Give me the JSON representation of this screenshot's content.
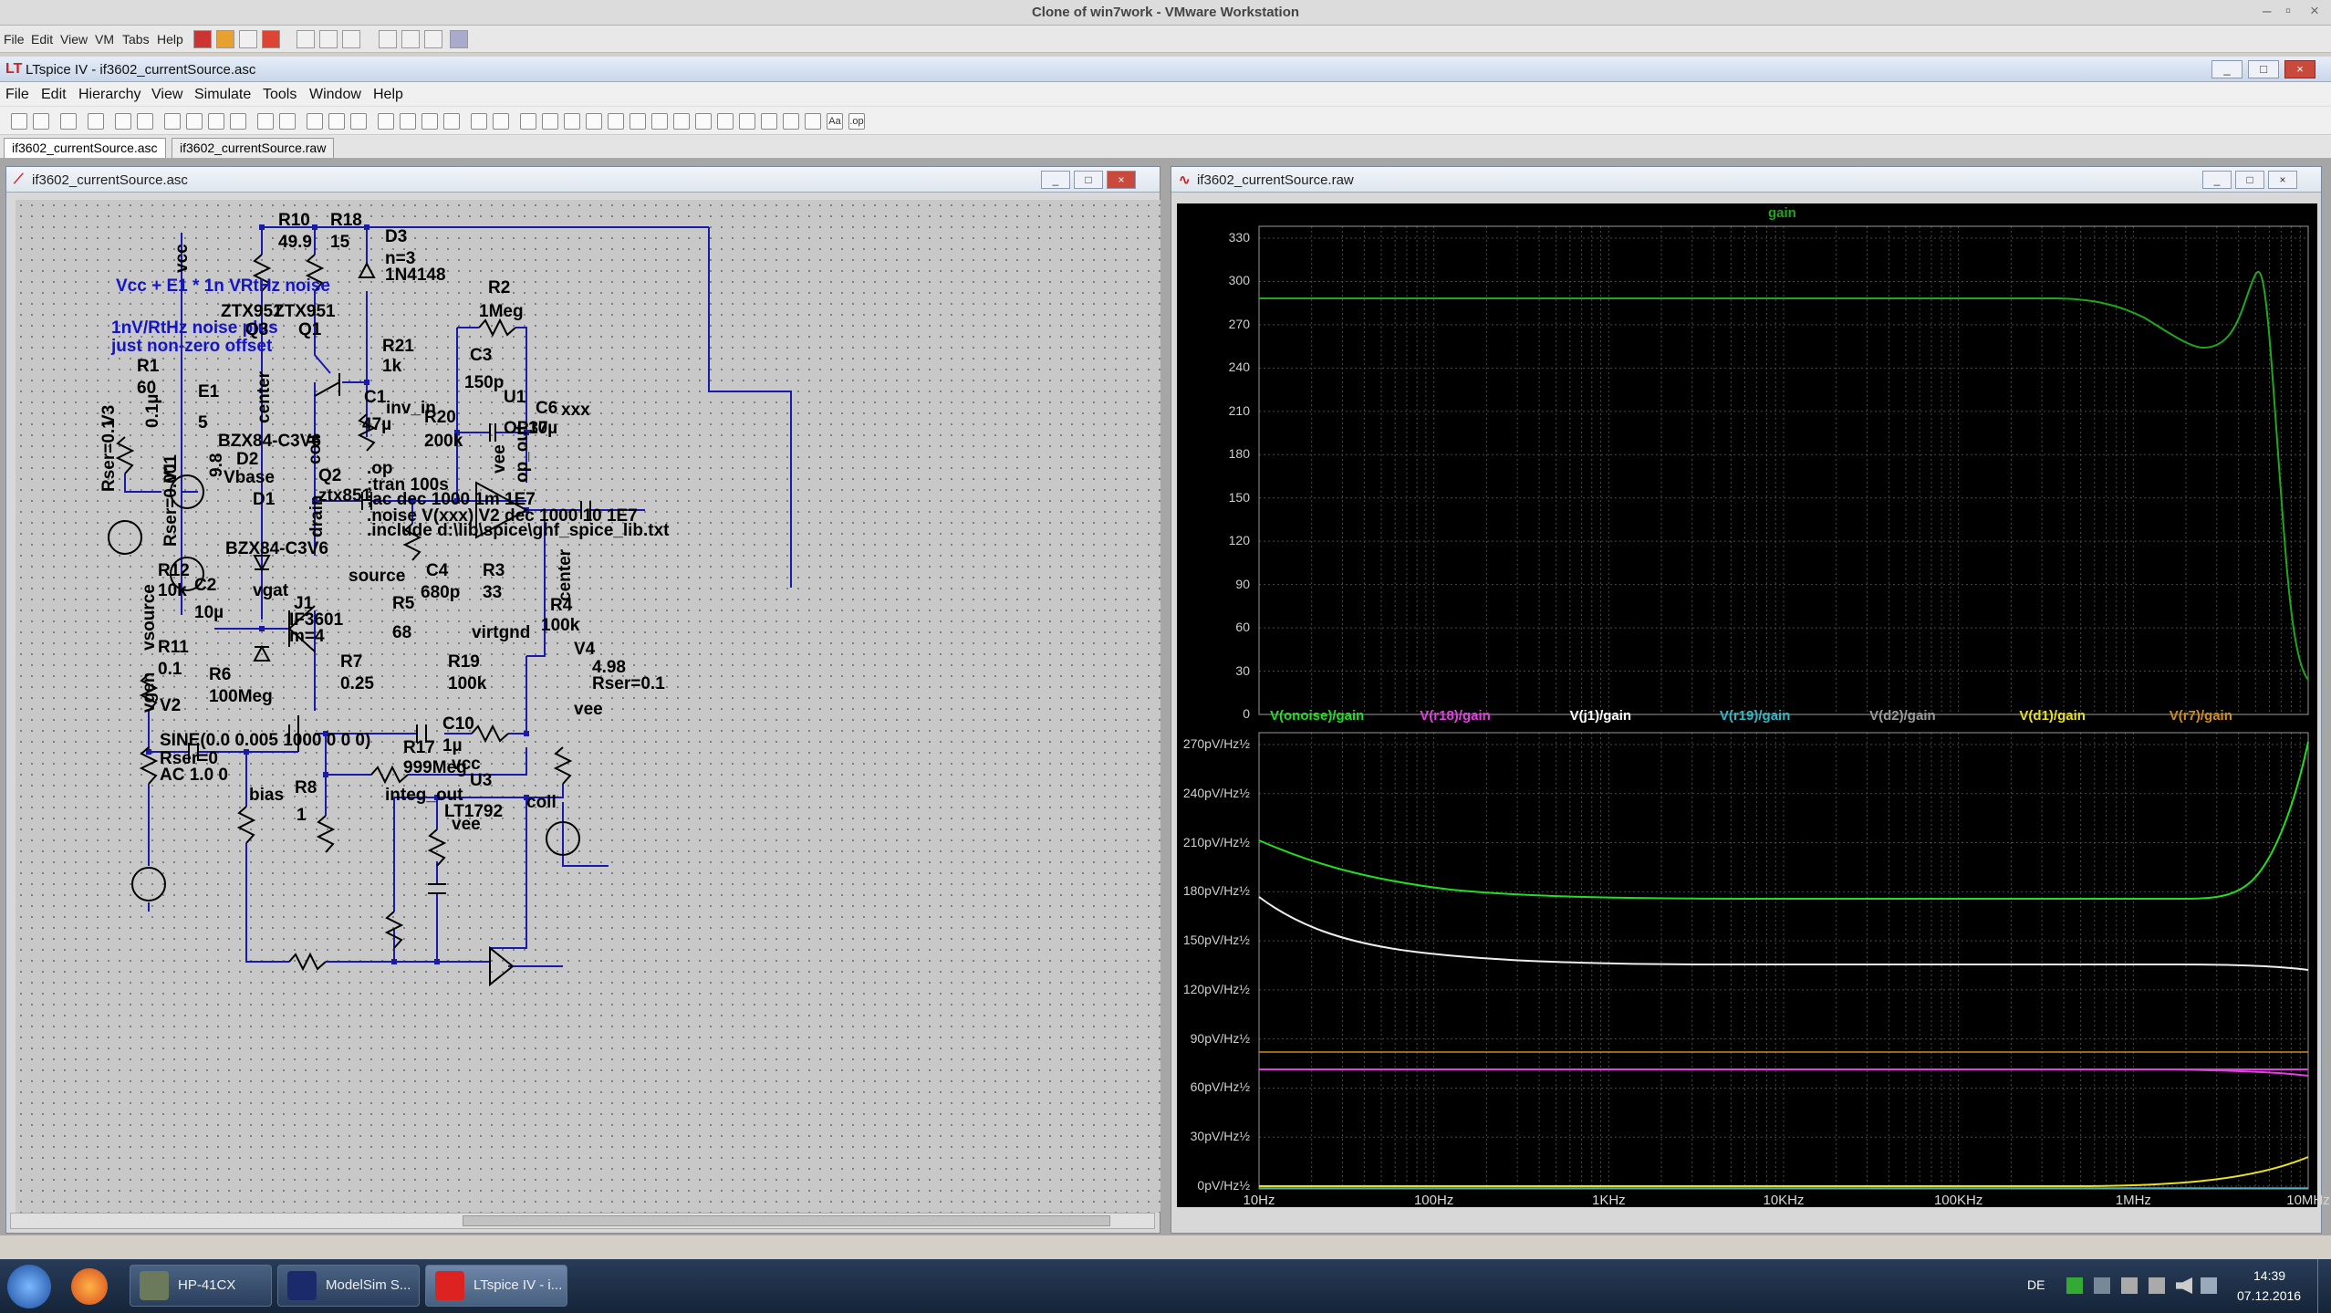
{
  "vmware": {
    "title": "Clone of win7work - VMware Workstation",
    "menu": [
      "File",
      "Edit",
      "View",
      "VM",
      "Tabs",
      "Help"
    ]
  },
  "ltspice": {
    "title": "LTspice IV - if3602_currentSource.asc",
    "menu": [
      "File",
      "Edit",
      "Hierarchy",
      "View",
      "Simulate",
      "Tools",
      "Window",
      "Help"
    ],
    "tabs": [
      "if3602_currentSource.asc",
      "if3602_currentSource.raw"
    ]
  },
  "schematic_window": {
    "title": "if3602_currentSource.asc",
    "labels": {
      "vcc_top": "vcc",
      "vcc_noise": "Vcc + E1 * 1n VRtHz noise",
      "noise1": "1nV/RtHz noise plus",
      "noise2": "just non-zero offset",
      "r10": "R10",
      "r10v": "49.9",
      "r18": "R18",
      "r18v": "15",
      "d3": "D3",
      "d3n": "n=3",
      "d3v": "1N4148",
      "r2": "R2",
      "r2v": "1Meg",
      "ztx1": "ZTX951",
      "ztx2": "ZTX951",
      "q3": "Q3",
      "q1": "Q1",
      "r21": "R21",
      "r21v": "1k",
      "c3": "C3",
      "c3v": "150p",
      "r1": "R1",
      "r1v": "60",
      "e1": "E1",
      "e1v": "5",
      "center": "center",
      "c1": "C1",
      "c1v": "47µ",
      "inv_in": "inv_in",
      "u1": "U1",
      "c6": "C6",
      "c6v": "10µ",
      "xxx": "xxx",
      "v3": "V3",
      "v3v": "0.1µ",
      "r20": "R20",
      "r20v": "200k",
      "op37": "OP37",
      "rser01": "Rser=0.1",
      "bzx1": "BZX84-C3V6",
      "d2": "D2",
      "coll": "coll",
      "vee1": "vee",
      "op_out": "op_out",
      "v1": "V1",
      "v1v": "9.8",
      "vbase": "Vbase",
      "q2": "Q2",
      "ztx851": "ztx851",
      "d1": "D1",
      "rser0001": "Rser=0.001",
      "dot_op": ".op",
      "dot_tran": ";tran 100s",
      "dot_ac": ";ac dec 1000 1m 1E7",
      "dot_noise": ".noise V(xxx) V2 dec 1000 10 1E7",
      "dot_inc": ".include d:\\lib\\spice\\ghf_spice_lib.txt",
      "drain": "drain",
      "bzx2": "BZX84-C3V6",
      "r12": "R12",
      "r12v": "10k",
      "c2": "C2",
      "c2v": "10µ",
      "vgat": "vgat",
      "source": "source",
      "c4": "C4",
      "c4v": "680p",
      "r3": "R3",
      "r3v": "33",
      "j1": "J1",
      "if3601": "IF3601",
      "m4": "m=4",
      "r5": "R5",
      "r5v": "68",
      "center2": "center",
      "r4": "R4",
      "r4v": "100k",
      "vsource": "vsource",
      "r11": "R11",
      "r11v": "0.1",
      "r6": "R6",
      "r6v": "100Meg",
      "virtgnd": "virtgnd",
      "v4": "V4",
      "v4v": "4.98",
      "v4r": "Rser=0.1",
      "r7": "R7",
      "r7v": "0.25",
      "r19": "R19",
      "r19v": "100k",
      "vgen": "vgen",
      "v2": "V2",
      "vee2": "vee",
      "c10": "C10",
      "c10v": "1µ",
      "sine": "SINE(0.0 0.005 1000 0 0 0)",
      "rser0": "Rser=0",
      "ac": "AC 1.0 0",
      "r17": "R17",
      "r17v": "999Meg",
      "vcc2": "vcc",
      "bias": "bias",
      "r8": "R8",
      "r8v": "1",
      "integ_out": "integ_out",
      "u3": "U3",
      "coll2": "coll",
      "lt1792": "LT1792",
      "vee3": "vee"
    }
  },
  "waveform_window": {
    "title": "if3602_currentSource.raw",
    "top_trace": "gain",
    "top_yticks": [
      "330",
      "300",
      "270",
      "240",
      "210",
      "180",
      "150",
      "120",
      "90",
      "60",
      "30",
      "0"
    ],
    "legend": [
      {
        "label": "V(onoise)/gain",
        "color": "#22dd22"
      },
      {
        "label": "V(r18)/gain",
        "color": "#e23fe2"
      },
      {
        "label": "V(j1)/gain",
        "color": "#ffffff"
      },
      {
        "label": "V(r19)/gain",
        "color": "#2fb8c8"
      },
      {
        "label": "V(d2)/gain",
        "color": "#9a9a9a"
      },
      {
        "label": "V(d1)/gain",
        "color": "#e8e020"
      },
      {
        "label": "V(r7)/gain",
        "color": "#d08a20"
      }
    ],
    "bottom_yticks": [
      "270pV/Hz½",
      "240pV/Hz½",
      "210pV/Hz½",
      "180pV/Hz½",
      "150pV/Hz½",
      "120pV/Hz½",
      "90pV/Hz½",
      "60pV/Hz½",
      "30pV/Hz½",
      "0pV/Hz½"
    ],
    "xticks": [
      "10Hz",
      "100Hz",
      "1KHz",
      "10KHz",
      "100KHz",
      "1MHz",
      "10MHz"
    ]
  },
  "taskbar": {
    "items": [
      "HP-41CX",
      "ModelSim S...",
      "LTspice IV - i..."
    ],
    "lang": "DE",
    "time": "14:39",
    "date": "07.12.2016"
  }
}
